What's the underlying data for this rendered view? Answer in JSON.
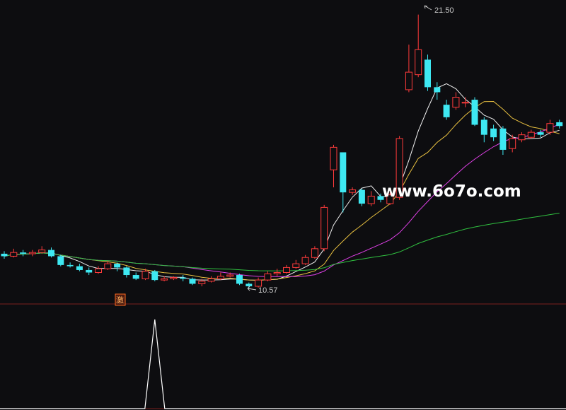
{
  "chart_data": {
    "type": "candlestick",
    "price_annotations": {
      "high_label": "21.50",
      "low_label": "10.57"
    },
    "signal_badge": "激",
    "watermark": "www.6o7o.com",
    "colors": {
      "up": "#ff3b3b",
      "down": "#3ee8f2",
      "ma5": "#f0f0f0",
      "ma10": "#e8c040",
      "ma20": "#e040e8",
      "ma60": "#30c040",
      "indicator": "#ffffff",
      "divider": "#7a1e1e",
      "background": "#0d0d10"
    },
    "ylim": [
      10.0,
      21.8
    ],
    "candles": [
      [
        11.95,
        11.85,
        12.05,
        11.75
      ],
      [
        11.85,
        12.0,
        12.15,
        11.8
      ],
      [
        12.0,
        11.95,
        12.1,
        11.85
      ],
      [
        11.95,
        12.0,
        12.1,
        11.85
      ],
      [
        12.0,
        12.1,
        12.25,
        11.95
      ],
      [
        12.1,
        11.85,
        12.2,
        11.8
      ],
      [
        11.85,
        11.5,
        11.9,
        11.45
      ],
      [
        11.5,
        11.45,
        11.6,
        11.4
      ],
      [
        11.45,
        11.3,
        11.55,
        11.25
      ],
      [
        11.3,
        11.2,
        11.4,
        11.1
      ],
      [
        11.2,
        11.35,
        11.45,
        11.15
      ],
      [
        11.35,
        11.55,
        11.65,
        11.3
      ],
      [
        11.55,
        11.4,
        11.6,
        11.25
      ],
      [
        11.4,
        11.1,
        11.45,
        11.0
      ],
      [
        11.1,
        10.95,
        11.2,
        10.9
      ],
      [
        10.95,
        11.25,
        11.35,
        10.9
      ],
      [
        11.25,
        10.9,
        11.3,
        10.85
      ],
      [
        10.9,
        10.95,
        11.05,
        10.85
      ],
      [
        10.95,
        11.0,
        11.05,
        10.9
      ],
      [
        11.0,
        10.95,
        11.1,
        10.85
      ],
      [
        10.95,
        10.75,
        11.0,
        10.7
      ],
      [
        10.75,
        10.85,
        10.95,
        10.65
      ],
      [
        10.85,
        10.95,
        11.05,
        10.8
      ],
      [
        10.95,
        11.05,
        11.2,
        10.9
      ],
      [
        11.05,
        11.1,
        11.2,
        11.0
      ],
      [
        11.1,
        10.75,
        11.15,
        10.7
      ],
      [
        10.75,
        10.65,
        10.8,
        10.57
      ],
      [
        10.65,
        10.9,
        11.0,
        10.6
      ],
      [
        10.9,
        11.15,
        11.25,
        10.85
      ],
      [
        11.15,
        11.2,
        11.35,
        11.05
      ],
      [
        11.2,
        11.4,
        11.5,
        11.15
      ],
      [
        11.4,
        11.55,
        11.7,
        11.35
      ],
      [
        11.55,
        11.8,
        11.9,
        11.5
      ],
      [
        11.8,
        12.15,
        12.25,
        11.75
      ],
      [
        12.15,
        13.8,
        13.9,
        12.05
      ],
      [
        15.3,
        16.2,
        16.3,
        14.6
      ],
      [
        16.0,
        14.4,
        14.7,
        13.6
      ],
      [
        14.4,
        14.5,
        14.6,
        14.3
      ],
      [
        14.5,
        13.95,
        14.55,
        13.85
      ],
      [
        13.95,
        14.25,
        14.45,
        13.85
      ],
      [
        14.25,
        14.1,
        14.35,
        14.0
      ],
      [
        13.95,
        14.3,
        14.4,
        13.9
      ],
      [
        14.2,
        16.55,
        16.65,
        14.1
      ],
      [
        18.5,
        19.2,
        20.3,
        18.4
      ],
      [
        19.1,
        20.1,
        21.5,
        19.0
      ],
      [
        19.7,
        18.6,
        19.9,
        18.45
      ],
      [
        18.6,
        18.4,
        18.8,
        18.1
      ],
      [
        17.9,
        17.4,
        18.1,
        17.3
      ],
      [
        17.8,
        18.2,
        18.4,
        17.7
      ],
      [
        18.0,
        18.0,
        18.2,
        17.8
      ],
      [
        18.1,
        17.1,
        18.2,
        17.05
      ],
      [
        17.3,
        16.7,
        17.4,
        16.4
      ],
      [
        16.95,
        16.6,
        17.1,
        16.45
      ],
      [
        16.95,
        16.1,
        17.05,
        15.9
      ],
      [
        16.15,
        16.55,
        16.7,
        16.0
      ],
      [
        16.5,
        16.7,
        16.8,
        16.4
      ],
      [
        16.6,
        16.8,
        16.9,
        16.55
      ],
      [
        16.8,
        16.7,
        16.9,
        16.6
      ],
      [
        16.8,
        17.15,
        17.3,
        16.7
      ],
      [
        17.2,
        17.05,
        17.3,
        16.95
      ]
    ],
    "indicator_values": [
      0,
      0,
      0,
      0,
      0,
      0,
      0,
      0,
      0,
      0,
      0,
      0,
      0,
      0,
      0,
      0,
      1,
      0,
      0,
      0,
      0,
      0,
      0,
      0,
      0,
      0,
      0,
      0,
      0,
      0,
      0,
      0,
      0,
      0,
      0,
      0,
      0,
      0,
      0,
      0,
      0,
      0,
      0,
      0,
      0,
      0,
      0,
      0,
      0,
      0,
      0,
      0,
      0,
      0,
      0,
      0,
      0,
      0,
      0,
      0
    ]
  }
}
